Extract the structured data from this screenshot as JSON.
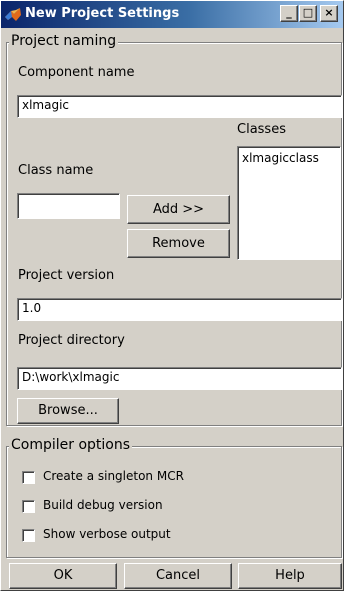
{
  "window": {
    "title": "New Project Settings",
    "min_label": "_",
    "max_label": "□",
    "close_label": "×"
  },
  "project_naming": {
    "legend": "Project naming",
    "component_name_label": "Component name",
    "component_name_value": "xlmagic",
    "classes_label": "Classes",
    "classes": [
      "xlmagicclass"
    ],
    "class_name_label": "Class name",
    "class_name_value": "",
    "add_label": "Add >>",
    "remove_label": "Remove",
    "project_version_label": "Project version",
    "project_version_value": "1.0",
    "project_directory_label": "Project directory",
    "project_directory_value": "D:\\work\\xlmagic",
    "browse_label": "Browse..."
  },
  "compiler_options": {
    "legend": "Compiler options",
    "options": [
      {
        "label": "Create a singleton MCR",
        "checked": false
      },
      {
        "label": "Build debug version",
        "checked": false
      },
      {
        "label": "Show verbose output",
        "checked": false
      }
    ]
  },
  "footer": {
    "ok_label": "OK",
    "cancel_label": "Cancel",
    "help_label": "Help"
  }
}
